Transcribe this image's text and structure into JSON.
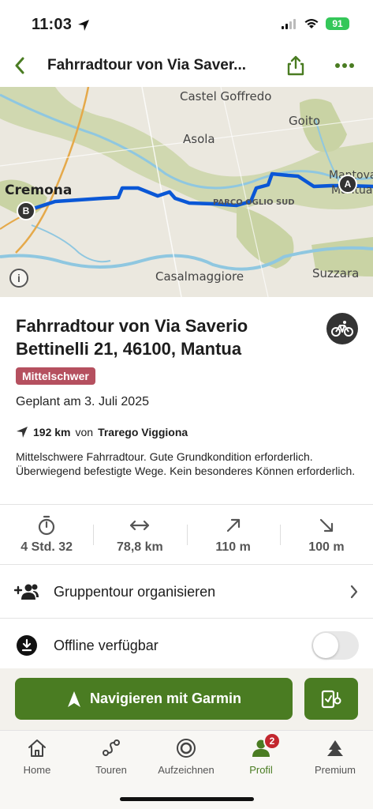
{
  "status_bar": {
    "time": "11:03",
    "battery": "91",
    "location_icon": "location-arrow-icon",
    "signal_icon": "signal-icon",
    "wifi_icon": "wifi-icon"
  },
  "nav": {
    "title": "Fahrradtour von Via Saver...",
    "back_icon": "chevron-left-icon",
    "share_icon": "share-icon",
    "more_icon": "more-dots-icon"
  },
  "map": {
    "labels": {
      "castel_goffredo": "Castel Goffredo",
      "goito": "Goito",
      "asola": "Asola",
      "mantova": "Mantova",
      "mantua": "Mantua",
      "cremona": "Cremona",
      "casalmaggiore": "Casalmaggiore",
      "suzzara": "Suzzara",
      "oglio_sud": "PARCO OGLIO SUD"
    },
    "start_marker": "A",
    "end_marker": "B",
    "info": "i",
    "route_color": "#0a57d6"
  },
  "tour": {
    "title": "Fahrradtour von Via Saverio Bettinelli 21, 46100, Mantua",
    "difficulty": "Mittelschwer",
    "planned": "Geplant am 3. Juli 2025",
    "distance": "192 km",
    "distance_from_word": "von",
    "distance_from": "Trarego Viggiona",
    "description": "Mittelschwere Fahrradtour. Gute Grundkondition erforderlich. Überwiegend befestigte Wege. Kein besonderes Können erforderlich.",
    "sport_icon": "bike-icon"
  },
  "stats": [
    {
      "icon": "stopwatch-icon",
      "value": "4 Std. 32"
    },
    {
      "icon": "distance-arrows-icon",
      "value": "78,8 km"
    },
    {
      "icon": "ascent-arrow-icon",
      "value": "110 m"
    },
    {
      "icon": "descent-arrow-icon",
      "value": "100 m"
    }
  ],
  "rows": {
    "group_tour": "Gruppentour organisieren",
    "offline": "Offline verfügbar",
    "offline_enabled": false
  },
  "actions": {
    "navigate": "Navigieren mit Garmin"
  },
  "tabs": [
    {
      "label": "Home",
      "icon": "home-icon"
    },
    {
      "label": "Touren",
      "icon": "tours-icon"
    },
    {
      "label": "Aufzeichnen",
      "icon": "record-icon"
    },
    {
      "label": "Profil",
      "icon": "profile-icon",
      "badge": "2",
      "active": true
    },
    {
      "label": "Premium",
      "icon": "premium-icon"
    }
  ],
  "colors": {
    "accent": "#4a7c22",
    "difficulty": "#b5505f",
    "badge": "#c3272e"
  }
}
